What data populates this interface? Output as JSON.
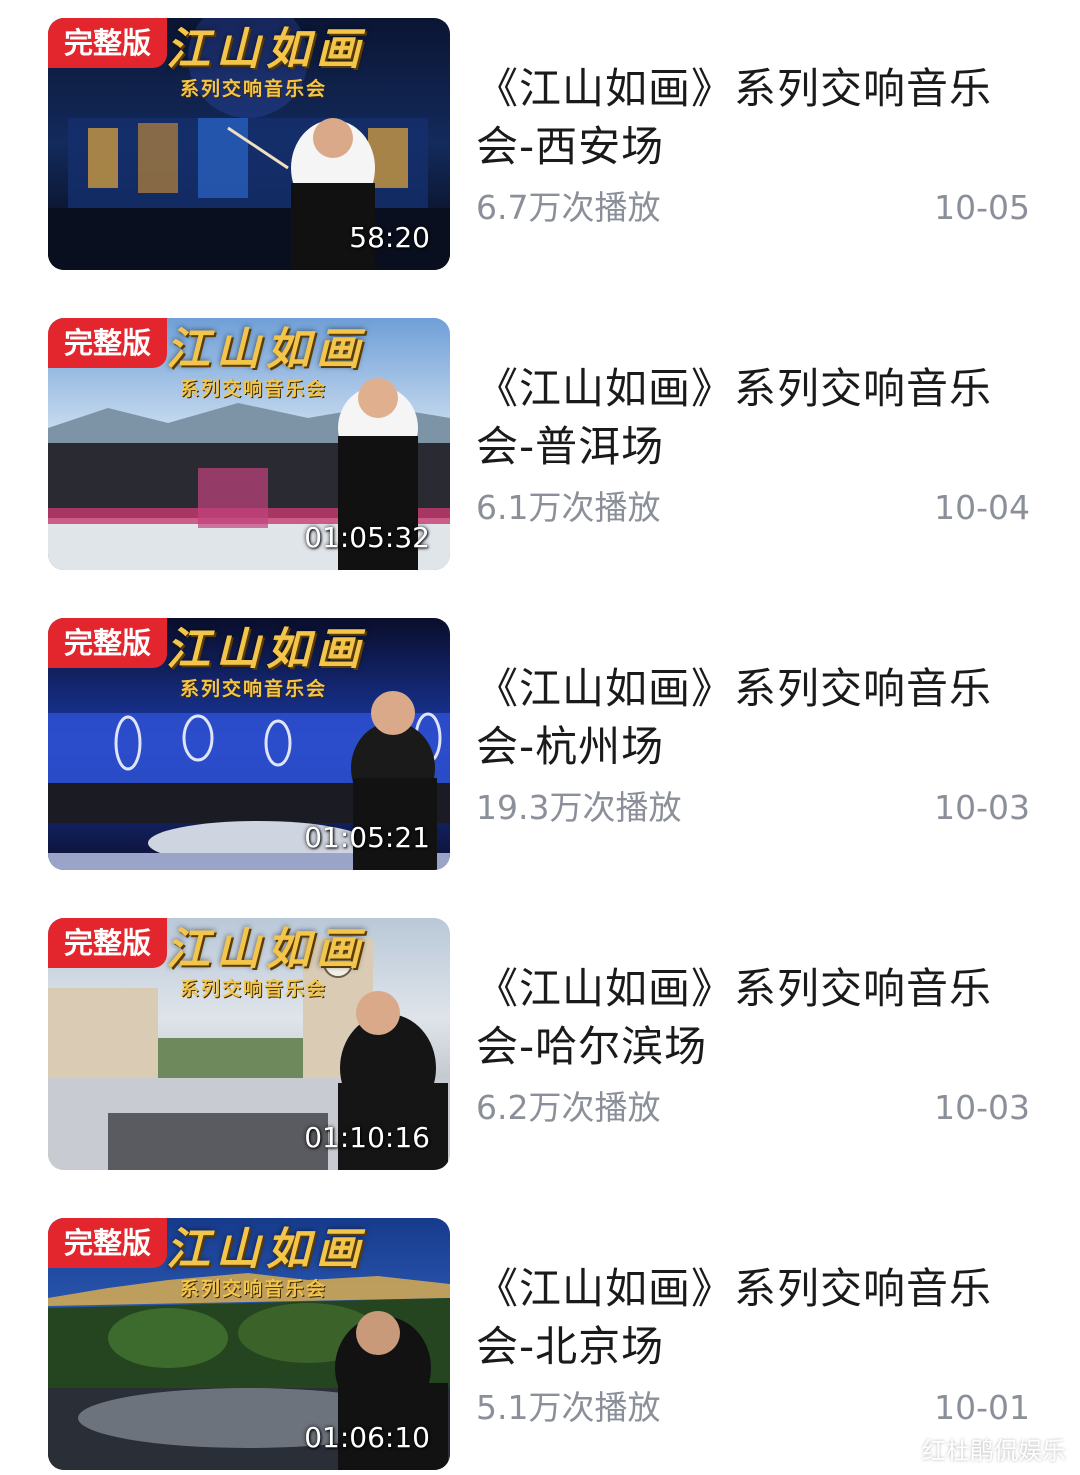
{
  "videos": [
    {
      "badge": "完整版",
      "thumb_title": "江山如画",
      "thumb_subtitle": "系列交响音乐会",
      "duration": "58:20",
      "title": "《江山如画》系列交响音乐会-西安场",
      "views": "6.7万次播放",
      "date": "10-05"
    },
    {
      "badge": "完整版",
      "thumb_title": "江山如画",
      "thumb_subtitle": "系列交响音乐会",
      "duration": "01:05:32",
      "title": "《江山如画》系列交响音乐会-普洱场",
      "views": "6.1万次播放",
      "date": "10-04"
    },
    {
      "badge": "完整版",
      "thumb_title": "江山如画",
      "thumb_subtitle": "系列交响音乐会",
      "duration": "01:05:21",
      "title": "《江山如画》系列交响音乐会-杭州场",
      "views": "19.3万次播放",
      "date": "10-03"
    },
    {
      "badge": "完整版",
      "thumb_title": "江山如画",
      "thumb_subtitle": "系列交响音乐会",
      "duration": "01:10:16",
      "title": "《江山如画》系列交响音乐会-哈尔滨场",
      "views": "6.2万次播放",
      "date": "10-03"
    },
    {
      "badge": "完整版",
      "thumb_title": "江山如画",
      "thumb_subtitle": "系列交响音乐会",
      "duration": "01:06:10",
      "title": "《江山如画》系列交响音乐会-北京场",
      "views": "5.1万次播放",
      "date": "10-01"
    }
  ],
  "watermark": "红杜鹃侃娱乐",
  "colors": {
    "badge_bg": "#e3262e",
    "title_text": "#1a1a1a",
    "meta_text": "#8a8f99",
    "thumb_title_gold": "#f3c54a"
  }
}
